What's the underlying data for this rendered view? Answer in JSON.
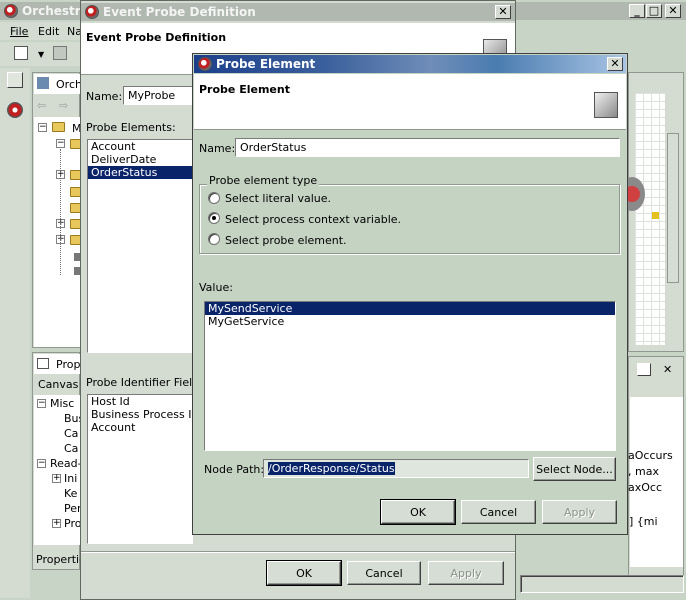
{
  "back_window": {
    "title": "Orchestra",
    "menu": [
      "File",
      "Edit",
      "Na"
    ],
    "tree_root": "Orch",
    "tree_item_m": "M",
    "props_tab": "Prop",
    "canvas_tab": "Canvas",
    "props": [
      "Misc",
      "Bus",
      "Ca",
      "Ca",
      "Read-",
      "Ini",
      "Ke",
      "Per",
      "Pro"
    ],
    "properties_footer": "Propertie",
    "right_snippets": [
      "aOccurs",
      ", max",
      "axOcc",
      "g]  {mi"
    ]
  },
  "event_probe_dialog": {
    "title": "Event Probe Definition",
    "heading": "Event Probe Definition",
    "name_label": "Name:",
    "name_value": "MyProbe",
    "probe_elements_label": "Probe Elements:",
    "probe_elements": [
      "Account",
      "DeliverDate",
      "OrderStatus"
    ],
    "selected_probe_element": "OrderStatus",
    "identifier_label": "Probe Identifier Fields",
    "identifier_fields": [
      "Host Id",
      "Business Process Inst",
      "Account"
    ],
    "ok": "OK",
    "cancel": "Cancel",
    "apply": "Apply"
  },
  "probe_element_dialog": {
    "title": "Probe Element",
    "heading": "Probe Element",
    "name_label": "Name:",
    "name_value": "OrderStatus",
    "type_group": "Probe element type",
    "radio_literal": "Select literal value.",
    "radio_context": "Select process context variable.",
    "radio_probe": "Select probe element.",
    "selected_type": "context",
    "value_label": "Value:",
    "values": [
      "MySendService",
      "MyGetService"
    ],
    "selected_value": "MySendService",
    "node_path_label": "Node Path:",
    "node_path_value": "/OrderResponse/Status",
    "select_node": "Select Node...",
    "ok": "OK",
    "cancel": "Cancel",
    "apply": "Apply"
  }
}
